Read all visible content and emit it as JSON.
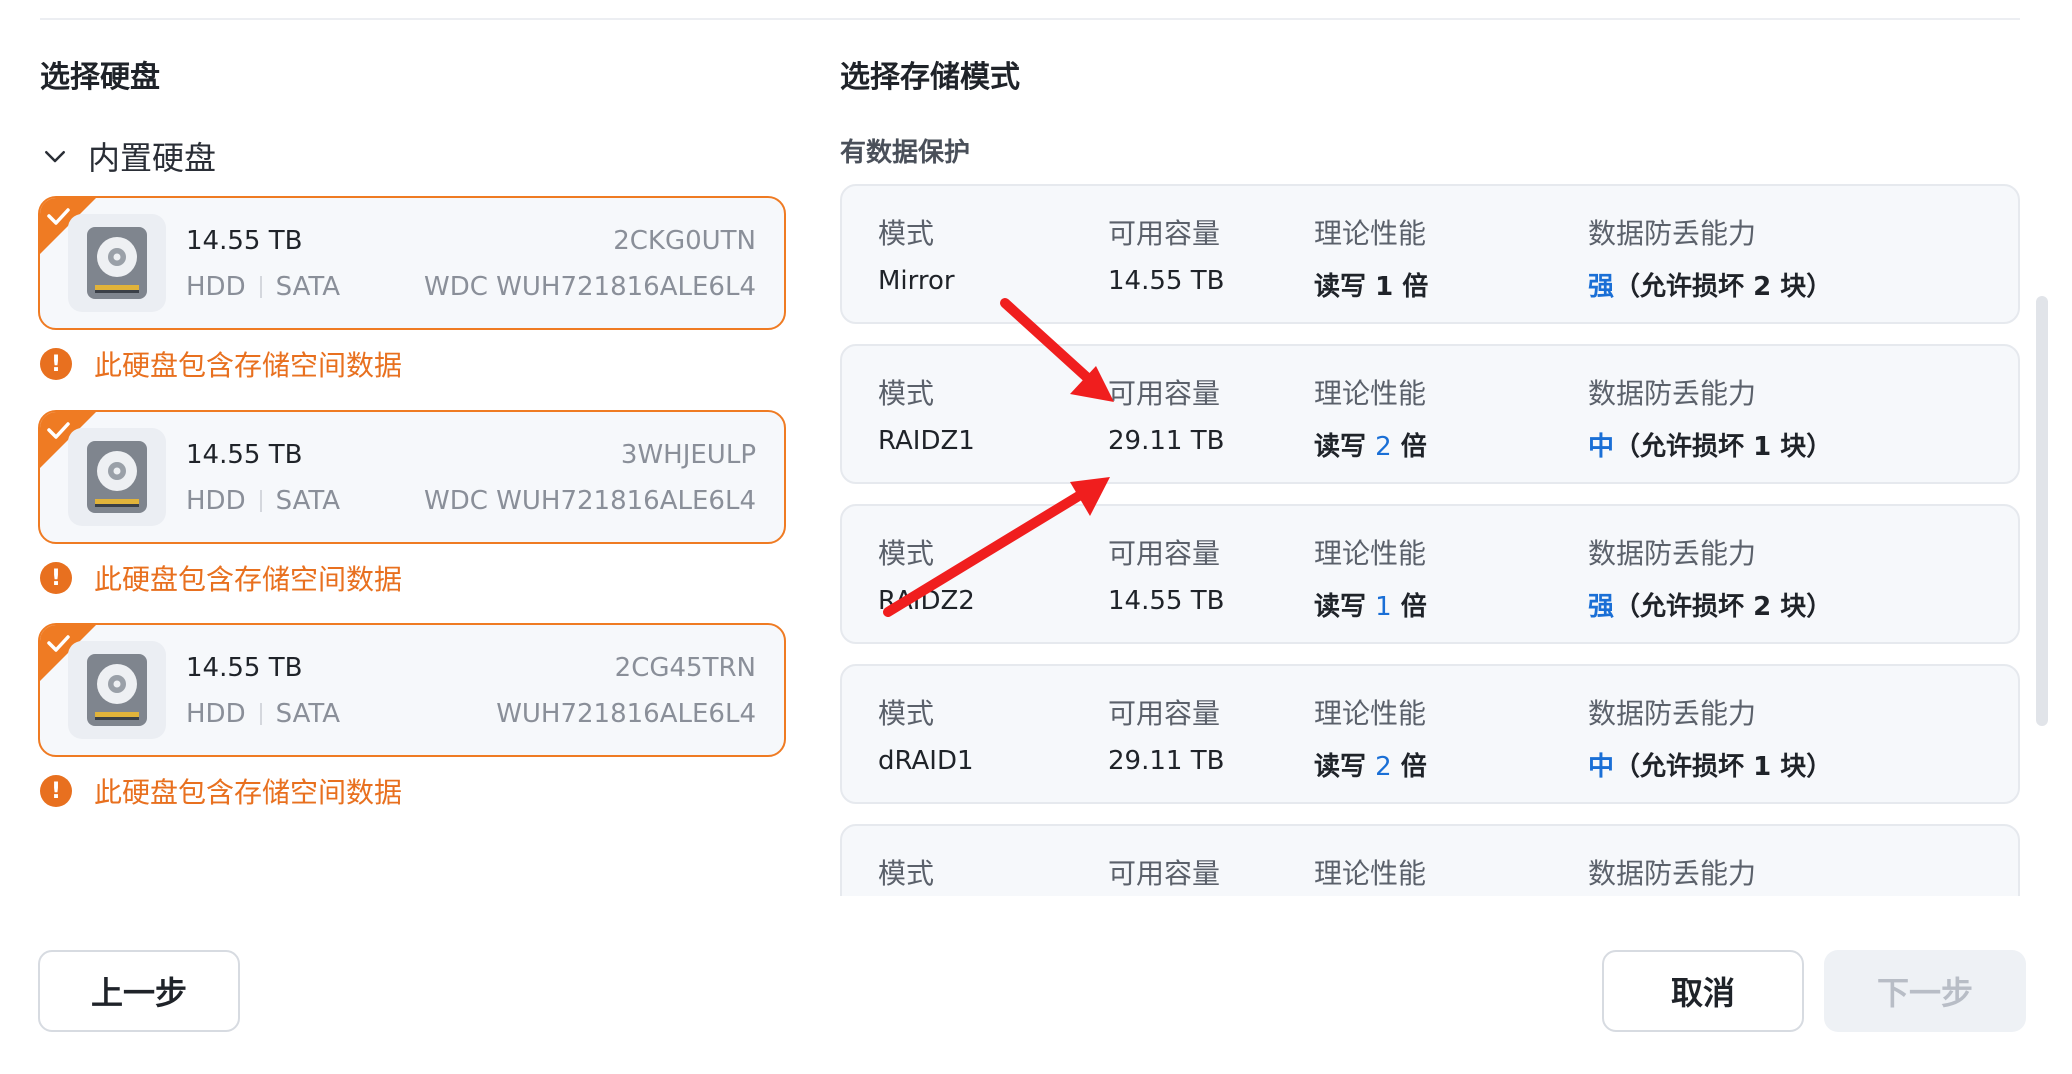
{
  "left": {
    "title": "选择硬盘",
    "group_label": "内置硬盘",
    "disks": [
      {
        "size": "14.55 TB",
        "serial": "2CKG0UTN",
        "type": "HDD",
        "interface": "SATA",
        "model": "WDC WUH721816ALE6L4",
        "warning": "此硬盘包含存储空间数据"
      },
      {
        "size": "14.55 TB",
        "serial": "3WHJEULP",
        "type": "HDD",
        "interface": "SATA",
        "model": "WDC WUH721816ALE6L4",
        "warning": "此硬盘包含存储空间数据"
      },
      {
        "size": "14.55 TB",
        "serial": "2CG45TRN",
        "type": "HDD",
        "interface": "SATA",
        "model": "WUH721816ALE6L4",
        "warning": "此硬盘包含存储空间数据"
      }
    ]
  },
  "right": {
    "title": "选择存储模式",
    "subsection": "有数据保护",
    "headers": {
      "mode": "模式",
      "capacity": "可用容量",
      "performance": "理论性能",
      "protection": "数据防丢能力"
    },
    "modes": [
      {
        "name": "Mirror",
        "capacity": "14.55 TB",
        "perf_prefix": "读写",
        "perf_num": "1",
        "perf_suffix": "倍",
        "prot_level": "强",
        "prot_text": "（允许损坏 2 块）"
      },
      {
        "name": "RAIDZ1",
        "capacity": "29.11 TB",
        "perf_prefix": "读写",
        "perf_num": "2",
        "perf_suffix": "倍",
        "prot_level": "中",
        "prot_text": "（允许损坏 1 块）"
      },
      {
        "name": "RAIDZ2",
        "capacity": "14.55 TB",
        "perf_prefix": "读写",
        "perf_num": "1",
        "perf_suffix": "倍",
        "prot_level": "强",
        "prot_text": "（允许损坏 2 块）"
      },
      {
        "name": "dRAID1",
        "capacity": "29.11 TB",
        "perf_prefix": "读写",
        "perf_num": "2",
        "perf_suffix": "倍",
        "prot_level": "中",
        "prot_text": "（允许损坏 1 块）"
      },
      {
        "name": "",
        "capacity": "",
        "perf_prefix": "",
        "perf_num": "",
        "perf_suffix": "",
        "prot_level": "",
        "prot_text": ""
      }
    ]
  },
  "footer": {
    "prev_label": "上一步",
    "cancel_label": "取消",
    "next_label": "下一步"
  },
  "colors": {
    "accent_orange": "#ef7b23",
    "warning_orange": "#e8701f",
    "link_blue": "#1a6fd6",
    "annotation_red": "#f01e1e"
  }
}
